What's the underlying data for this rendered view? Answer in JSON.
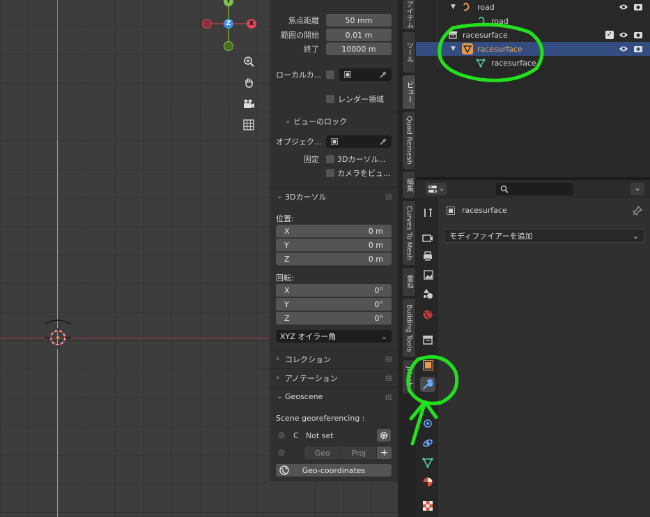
{
  "npanel": {
    "view": {
      "focal_label": "焦点距離",
      "focal_value": "50 mm",
      "clip_start_label": "範囲の開始",
      "clip_start_value": "0.01 m",
      "clip_end_label": "終了",
      "clip_end_value": "10000 m",
      "local_camera_label": "ローカルカ...",
      "render_region_label": "レンダー領域"
    },
    "view_lock": {
      "title": "ビューのロック",
      "object_label": "オブジェク...",
      "lock_label": "固定",
      "lock_cursor": "3Dカーソル...",
      "lock_camera": "カメラをビュ..."
    },
    "cursor": {
      "title": "3Dカーソル",
      "location_label": "位置:",
      "x_label": "X",
      "x_value": "0 m",
      "y_label": "Y",
      "y_value": "0 m",
      "z_label": "Z",
      "z_value": "0 m",
      "rotation_label": "回転:",
      "rx_label": "X",
      "rx_value": "0°",
      "ry_label": "Y",
      "ry_value": "0°",
      "rz_label": "Z",
      "rz_value": "0°",
      "rotation_mode": "XYZ オイラー角"
    },
    "collection_title": "コレクション",
    "annotation_title": "アノテーション",
    "geoscene": {
      "title": "Geoscene",
      "georef_label": "Scene georeferencing :",
      "crs_letter": "C",
      "crs_value": "Not set",
      "geo_label": "Geo",
      "proj_label": "Proj",
      "geo_coords_button": "Geo-coordinates"
    }
  },
  "tabs": [
    "アイテム",
    "ツール",
    "ビュー",
    "Quad Remesh",
    "編集",
    "Curves To Mesh",
    "重ね",
    "Building Tools",
    "JMesh"
  ],
  "gizmo": {
    "x": "X",
    "y": "Y",
    "z": "Z"
  },
  "outliner": {
    "rows": [
      {
        "name": "road"
      },
      {
        "name": "road"
      },
      {
        "name": "racesurface"
      },
      {
        "name": "racesurface"
      },
      {
        "name": "racesurface"
      }
    ]
  },
  "properties": {
    "object_name": "racesurface",
    "add_modifier": "モディファイアーを追加"
  },
  "colors": {
    "accent_green": "#22e01d",
    "selected_row": "#334d80",
    "x_axis": "#cc3344",
    "y_axis_top": "#6aa02c",
    "y_axis_bottom": "#d9942b",
    "object_orange": "#e69a4a"
  }
}
